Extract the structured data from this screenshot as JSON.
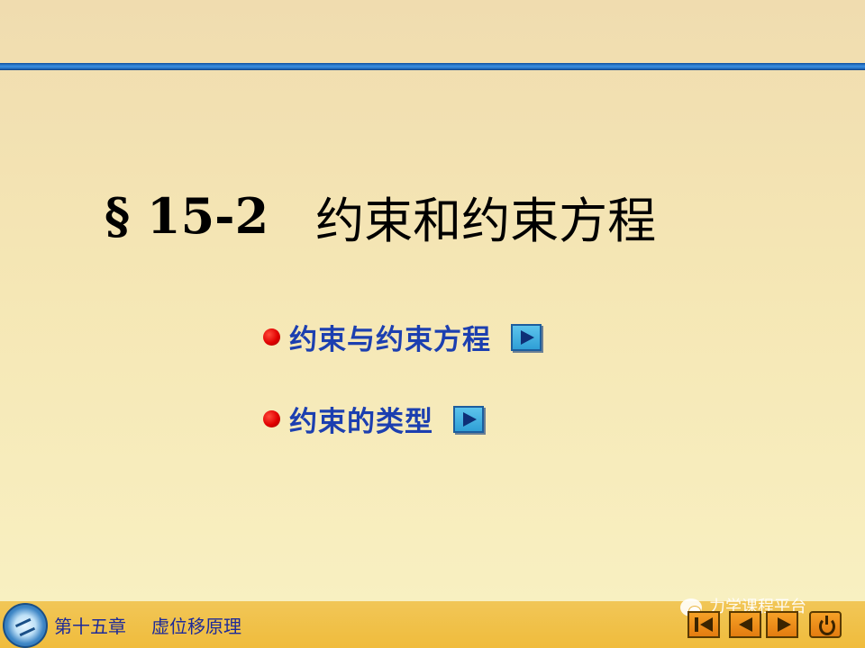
{
  "slide": {
    "section_number": "§ 15-2",
    "section_title": "约束和约束方程",
    "menu": [
      {
        "label": "约束与约束方程"
      },
      {
        "label": "约束的类型"
      }
    ]
  },
  "footer": {
    "chapter": "第十五章",
    "topic": "虚位移原理",
    "watermark": "力学课程平台",
    "nav": [
      "first-icon",
      "prev-icon",
      "next-icon",
      "exit-icon"
    ]
  },
  "colors": {
    "accent_blue": "#1c3fb0",
    "footer_bar": "#f0bc3c",
    "bullet_red": "#e00000",
    "rule_blue": "#2a78c9"
  }
}
